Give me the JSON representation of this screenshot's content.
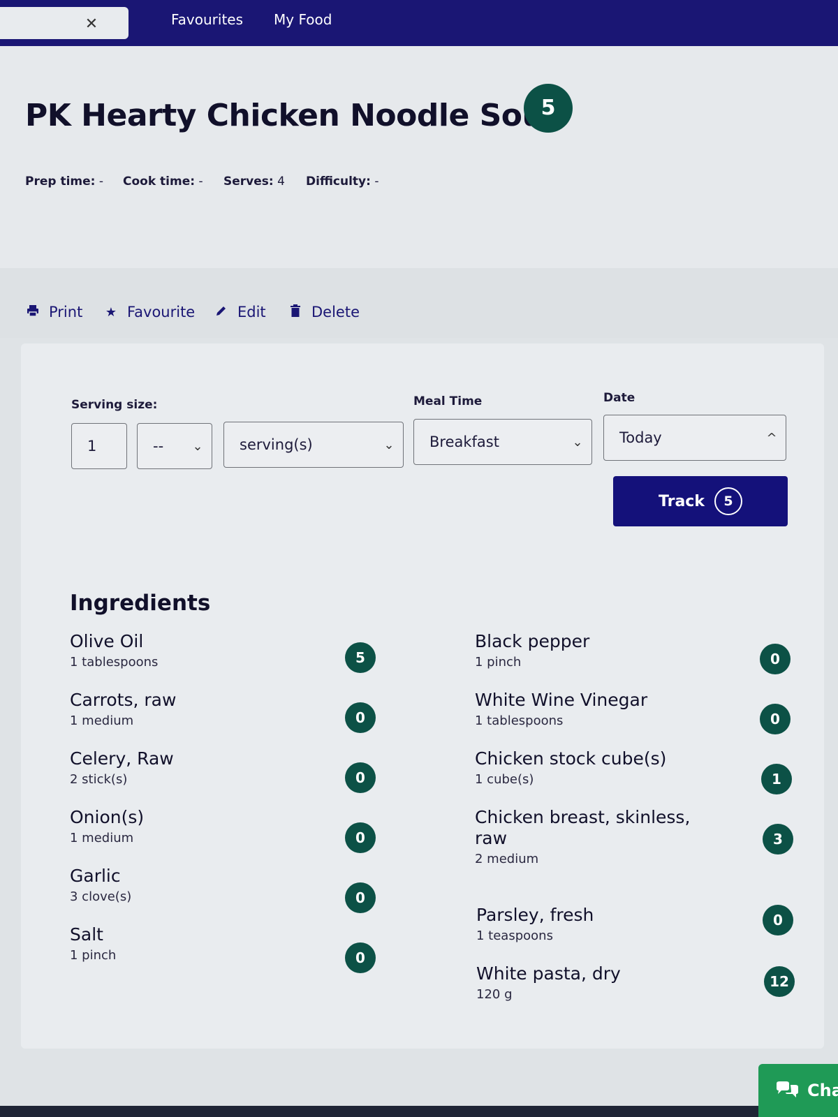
{
  "nav": {
    "close_glyph": "✕",
    "favourites": "Favourites",
    "my_food": "My Food"
  },
  "recipe": {
    "title": "PK Hearty Chicken Noodle Soup",
    "points": "5",
    "prep_label": "Prep time:",
    "prep_value": "-",
    "cook_label": "Cook time:",
    "cook_value": "-",
    "serves_label": "Serves:",
    "serves_value": "4",
    "difficulty_label": "Difficulty:",
    "difficulty_value": "-"
  },
  "actions": {
    "print": "Print",
    "favourite": "Favourite",
    "edit": "Edit",
    "delete": "Delete"
  },
  "form": {
    "serving_label": "Serving size:",
    "meal_label": "Meal Time",
    "date_label": "Date",
    "qty_value": "1",
    "fraction_value": "--",
    "unit_value": "serving(s)",
    "meal_value": "Breakfast",
    "date_value": "Today",
    "track_label": "Track",
    "track_points": "5"
  },
  "ingredients_heading": "Ingredients",
  "ingredients_left": [
    {
      "name": "Olive Oil",
      "qty": "1 tablespoons",
      "points": "5"
    },
    {
      "name": "Carrots, raw",
      "qty": "1 medium",
      "points": "0"
    },
    {
      "name": "Celery, Raw",
      "qty": "2 stick(s)",
      "points": "0"
    },
    {
      "name": "Onion(s)",
      "qty": "1 medium",
      "points": "0"
    },
    {
      "name": "Garlic",
      "qty": "3 clove(s)",
      "points": "0"
    },
    {
      "name": "Salt",
      "qty": "1 pinch",
      "points": "0"
    }
  ],
  "ingredients_right": [
    {
      "name": "Black pepper",
      "qty": "1 pinch",
      "points": "0"
    },
    {
      "name": "White Wine Vinegar",
      "qty": "1 tablespoons",
      "points": "0"
    },
    {
      "name": "Chicken stock cube(s)",
      "qty": "1 cube(s)",
      "points": "1"
    },
    {
      "name": "Chicken breast, skinless, raw",
      "qty": "2 medium",
      "points": "3"
    },
    {
      "name": "Parsley, fresh",
      "qty": "1 teaspoons",
      "points": "0"
    },
    {
      "name": "White pasta, dry",
      "qty": "120 g",
      "points": "12"
    }
  ],
  "chat": {
    "label": "Cha"
  },
  "colors": {
    "nav_bg": "#1a1674",
    "points_badge": "#0c5146",
    "track_button": "#14117a",
    "chat_button": "#1f9a56"
  }
}
